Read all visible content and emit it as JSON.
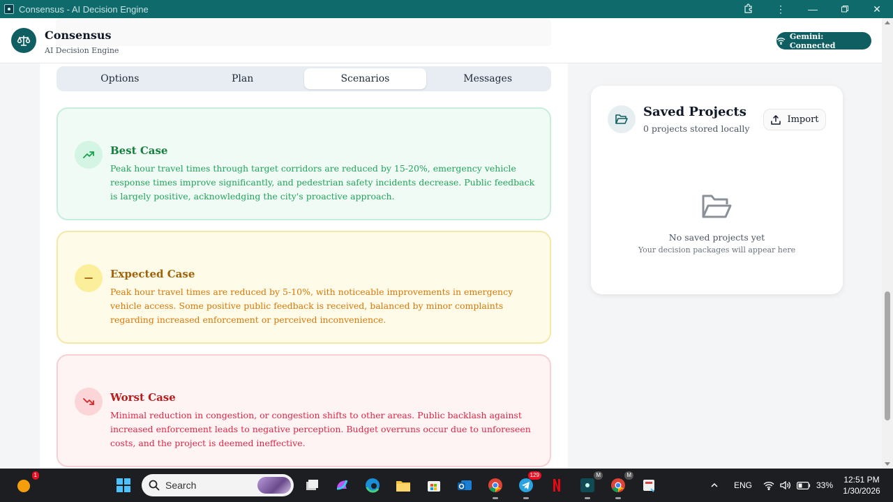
{
  "window": {
    "title": "Consensus - AI Decision Engine"
  },
  "header": {
    "brand_name": "Consensus",
    "brand_sub": "AI Decision Engine",
    "status": "Gemini: Connected"
  },
  "tabs": [
    {
      "label": "Options"
    },
    {
      "label": "Plan"
    },
    {
      "label": "Scenarios"
    },
    {
      "label": "Messages"
    }
  ],
  "active_tab": "Scenarios",
  "scenarios": {
    "best": {
      "title": "Best Case",
      "text": "Peak hour travel times through target corridors are reduced by 15-20%, emergency vehicle response times improve significantly, and pedestrian safety incidents decrease. Public feedback is largely positive, acknowledging the city's proactive approach."
    },
    "expected": {
      "title": "Expected Case",
      "text": "Peak hour travel times are reduced by 5-10%, with noticeable improvements in emergency vehicle access. Some positive public feedback is received, balanced by minor complaints regarding increased enforcement or perceived inconvenience."
    },
    "worst": {
      "title": "Worst Case",
      "text": "Minimal reduction in congestion, or congestion shifts to other areas. Public backlash against increased enforcement leads to negative perception. Budget overruns occur due to unforeseen costs, and the project is deemed ineffective."
    }
  },
  "saved_projects": {
    "title": "Saved Projects",
    "subtitle": "0 projects stored locally",
    "import_label": "Import",
    "empty_title": "No saved projects yet",
    "empty_sub": "Your decision packages will appear here"
  },
  "taskbar": {
    "search_placeholder": "Search",
    "weather_badge": "1",
    "telegram_badge": "129",
    "app_badge_letter": "M",
    "language": "ENG",
    "battery": "33%",
    "time": "12:51 PM",
    "date": "1/30/2026"
  },
  "colors": {
    "brand": "#0f5f62",
    "best": "#15803d",
    "expected": "#a16207",
    "worst": "#b91c1c"
  },
  "icons": {
    "logo": "scale-icon",
    "status": "wifi-icon",
    "best": "trending-up-icon",
    "expected": "minus-icon",
    "worst": "trending-down-icon",
    "folder": "folder-open-icon",
    "import": "upload-icon"
  }
}
